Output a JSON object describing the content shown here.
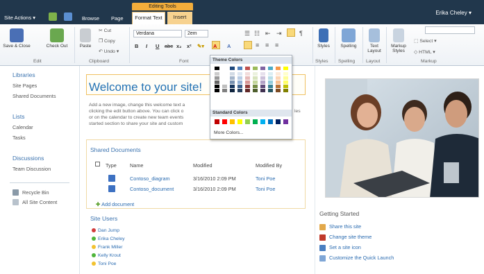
{
  "topbar": {
    "site_actions": "Site Actions ▾",
    "tabs": {
      "browse": "Browse",
      "page": "Page",
      "contextual_group": "Editing Tools",
      "format_text": "Format Text",
      "insert": "Insert"
    },
    "user": "Erika Cheley ▾"
  },
  "ribbon": {
    "edit": {
      "save_close": "Save & Close",
      "check_out": "Check Out",
      "group": "Edit"
    },
    "clipboard": {
      "paste": "Paste",
      "cut": "Cut",
      "copy": "Copy",
      "undo": "Undo",
      "group": "Clipboard"
    },
    "font": {
      "family": "Verdana",
      "size": "2em",
      "bold": "B",
      "italic": "I",
      "underline": "U",
      "strikethrough": "abc",
      "subscript": "x₂",
      "superscript": "x²",
      "group": "Font"
    },
    "styles": {
      "label": "Styles",
      "group": "Styles"
    },
    "spelling": {
      "label": "Spelling",
      "group": "Spelling"
    },
    "layout": {
      "label": "Text Layout",
      "group": "Layout"
    },
    "markup": {
      "styles": "Markup Styles",
      "select": "Select",
      "html": "HTML",
      "group": "Markup"
    }
  },
  "color_menu": {
    "theme_header": "Theme Colors",
    "standard_header": "Standard Colors",
    "more": "More Colors...",
    "theme_columns": [
      "#000000",
      "#ffffff",
      "#1f497d",
      "#4f81bd",
      "#c0504d",
      "#9bbb59",
      "#8064a2",
      "#4bacc6",
      "#f79646",
      "#ffff00"
    ],
    "standard_colors": [
      "#c00000",
      "#ff0000",
      "#ffc000",
      "#ffff00",
      "#92d050",
      "#00b050",
      "#00b0f0",
      "#0070c0",
      "#002060",
      "#7030a0"
    ]
  },
  "leftnav": {
    "libraries": "Libraries",
    "site_pages": "Site Pages",
    "shared_documents": "Shared Documents",
    "lists": "Lists",
    "calendar": "Calendar",
    "tasks": "Tasks",
    "discussions": "Discussions",
    "team_discussion": "Team Discussion",
    "recycle_bin": "Recycle Bin",
    "all_site_content": "All Site Content"
  },
  "main": {
    "welcome": "Welcome to your site!",
    "body_lines": [
      "Add a new image, change this welcome text a",
      "clicking the edit button above. You can click o",
      "or on the calendar to create new team events",
      "started section to share your site and custom"
    ],
    "body_right": [
      "les",
      ""
    ],
    "shared_docs_title": "Shared Documents",
    "columns": {
      "type": "Type",
      "name": "Name",
      "modified": "Modified",
      "modified_by": "Modified By"
    },
    "documents": [
      {
        "name": "Contoso_diagram",
        "modified": "3/16/2010 2:09 PM",
        "by": "Toni Poe"
      },
      {
        "name": "Contoso_document",
        "modified": "3/16/2010 2:09 PM",
        "by": "Toni Poe"
      }
    ],
    "add_document": "Add document",
    "site_users_title": "Site Users",
    "users": [
      "Dan Jump",
      "Erika Cheley",
      "Frank Miller",
      "Kelly Krout",
      "Toni Poe"
    ]
  },
  "getting_started": {
    "title": "Getting Started",
    "items": [
      "Share this site",
      "Change site theme",
      "Set a site icon",
      "Customize the Quick Launch"
    ]
  }
}
